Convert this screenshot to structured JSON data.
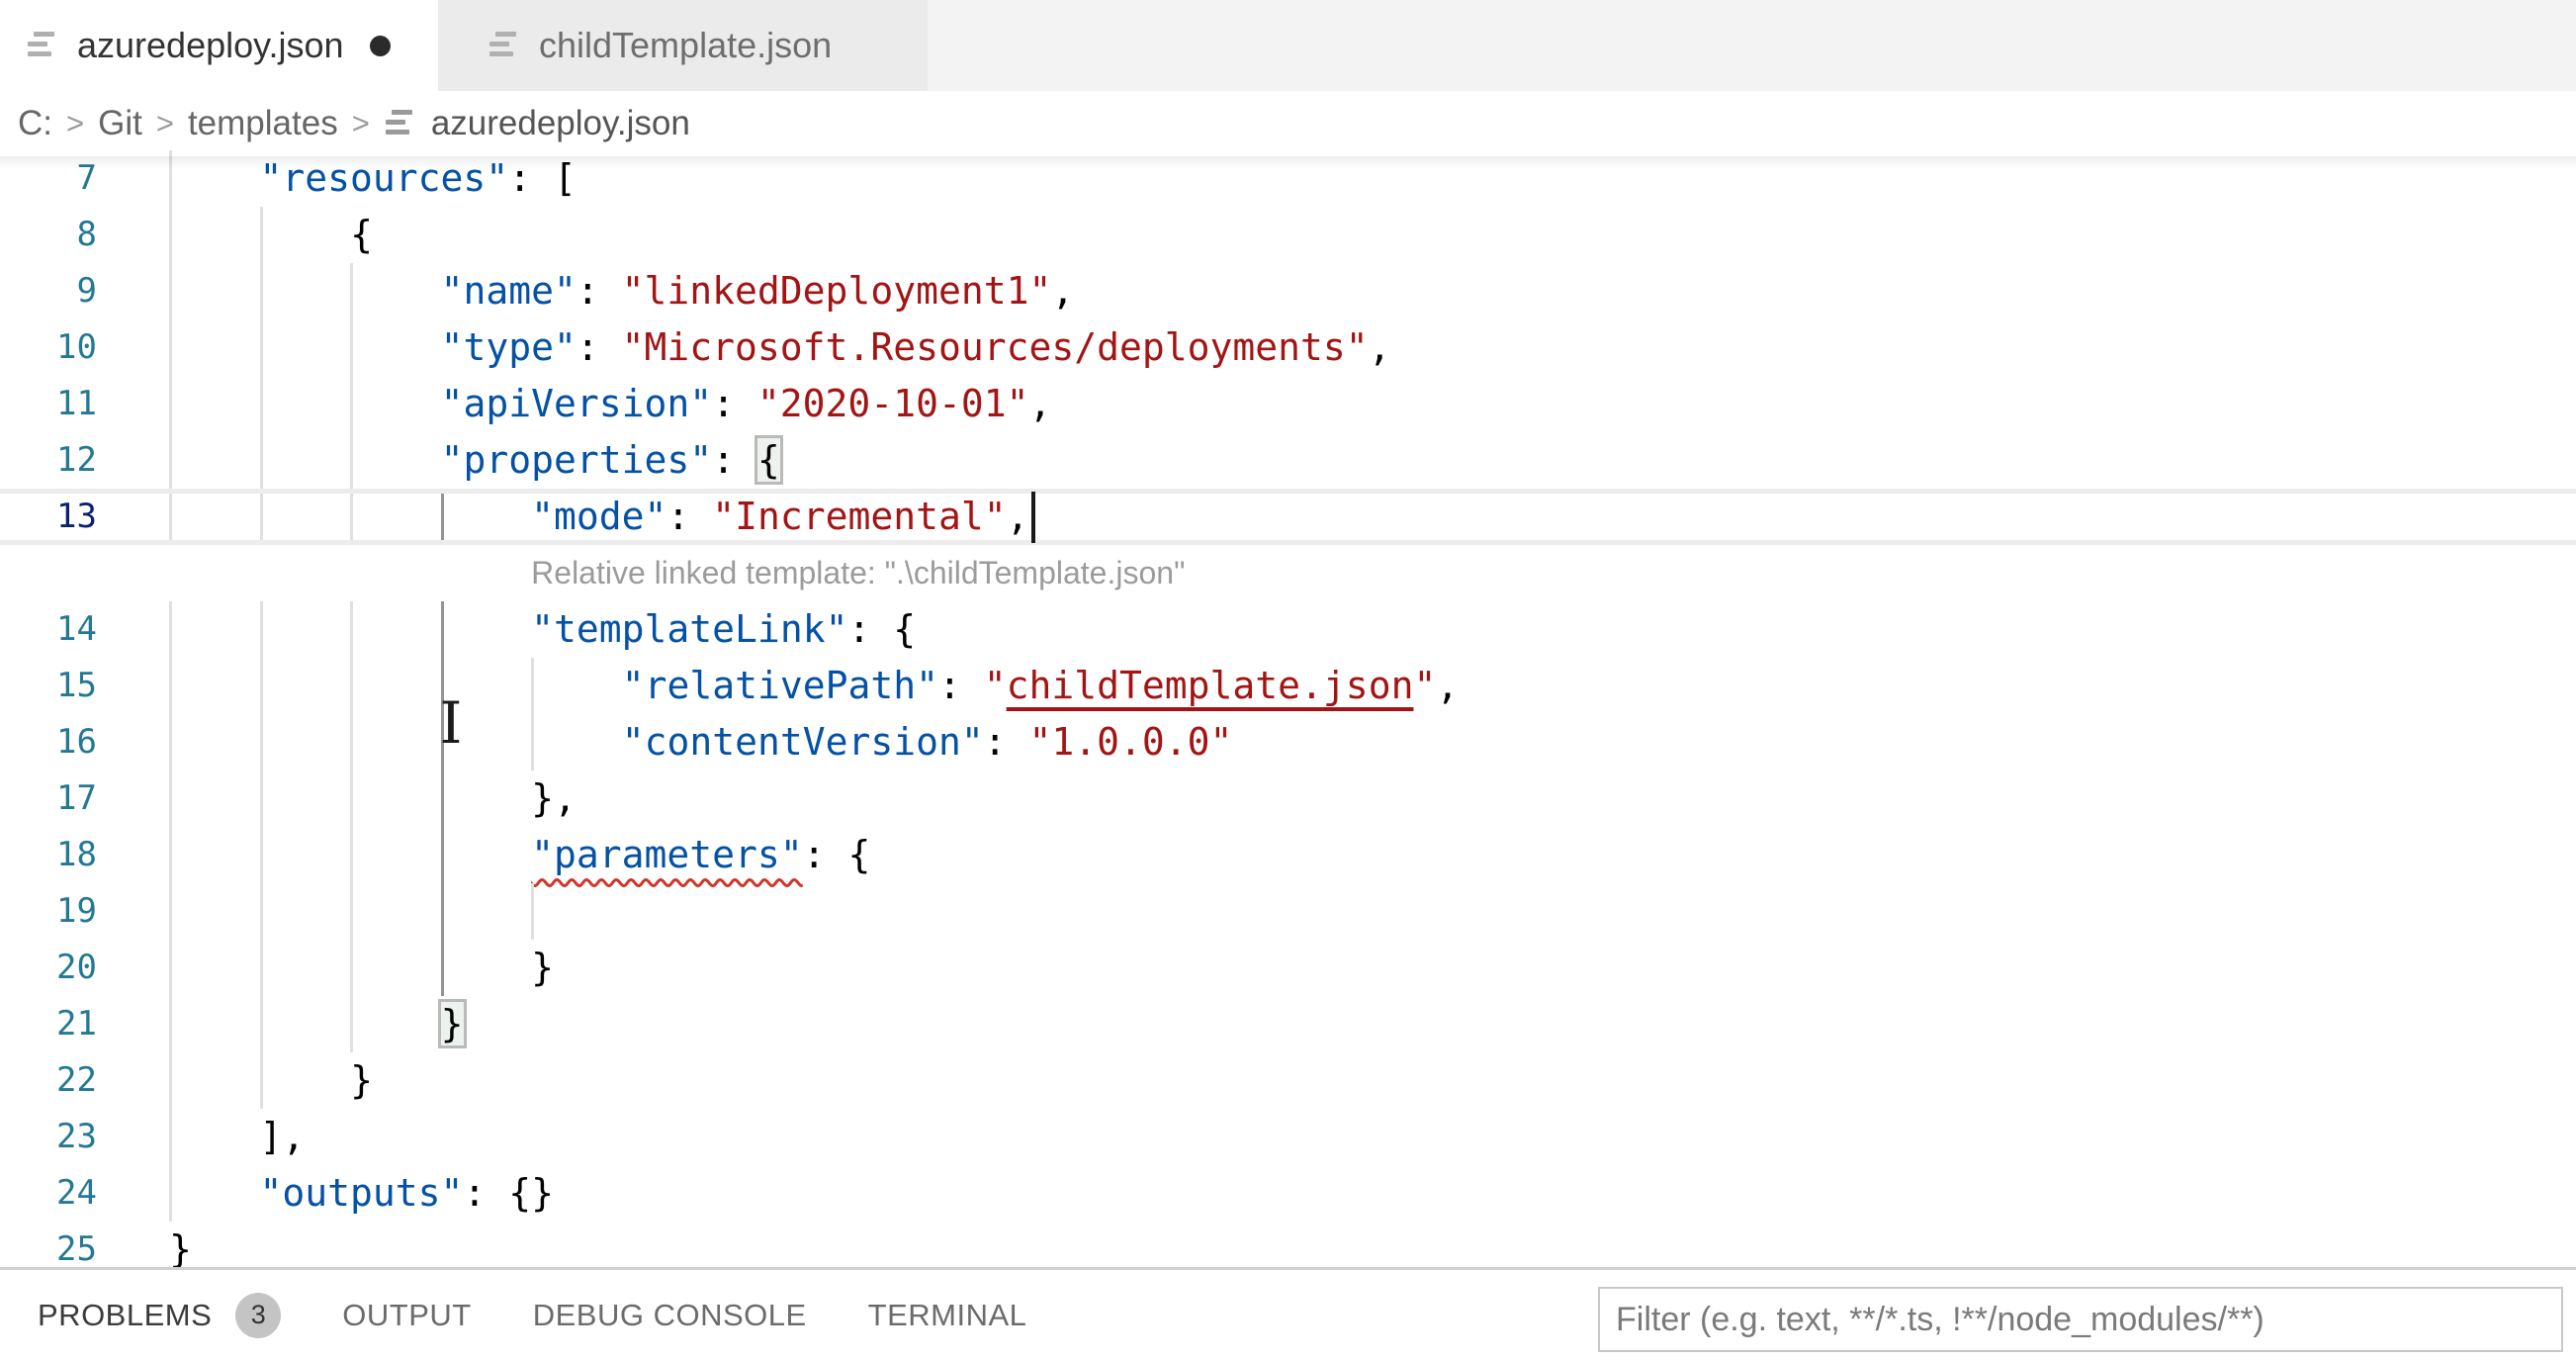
{
  "tabs": [
    {
      "title": "azuredeploy.json",
      "dirty": true,
      "active": true
    },
    {
      "title": "childTemplate.json",
      "dirty": false,
      "active": false
    }
  ],
  "breadcrumb": {
    "segments": [
      "C:",
      "Git",
      "templates"
    ],
    "separator": ">",
    "file": "azuredeploy.json"
  },
  "editor": {
    "lines": [
      {
        "num": 7,
        "indent": 4,
        "guides": [
          0
        ],
        "tokens": [
          [
            "key",
            "\"resources\""
          ],
          [
            "p",
            ": ["
          ]
        ]
      },
      {
        "num": 8,
        "indent": 8,
        "guides": [
          0,
          4
        ],
        "tokens": [
          [
            "p",
            "{"
          ]
        ]
      },
      {
        "num": 9,
        "indent": 12,
        "guides": [
          0,
          4,
          8
        ],
        "tokens": [
          [
            "key",
            "\"name\""
          ],
          [
            "p",
            ": "
          ],
          [
            "s",
            "\"linkedDeployment1\""
          ],
          [
            "p",
            ","
          ]
        ]
      },
      {
        "num": 10,
        "indent": 12,
        "guides": [
          0,
          4,
          8
        ],
        "tokens": [
          [
            "key",
            "\"type\""
          ],
          [
            "p",
            ": "
          ],
          [
            "s",
            "\"Microsoft.Resources/deployments\""
          ],
          [
            "p",
            ","
          ]
        ]
      },
      {
        "num": 11,
        "indent": 12,
        "guides": [
          0,
          4,
          8
        ],
        "tokens": [
          [
            "key",
            "\"apiVersion\""
          ],
          [
            "p",
            ": "
          ],
          [
            "s",
            "\"2020-10-01\""
          ],
          [
            "p",
            ","
          ]
        ]
      },
      {
        "num": 12,
        "indent": 12,
        "guides": [
          0,
          4,
          8
        ],
        "tokens": [
          [
            "key",
            "\"properties\""
          ],
          [
            "p",
            ": "
          ],
          [
            "bm",
            "{"
          ]
        ]
      },
      {
        "num": 13,
        "indent": 16,
        "guides": [
          0,
          4,
          8
        ],
        "active_guide": 12,
        "current": true,
        "caret": true,
        "tokens": [
          [
            "key",
            "\"mode\""
          ],
          [
            "p",
            ": "
          ],
          [
            "s",
            "\"Incremental\""
          ],
          [
            "p",
            ","
          ]
        ]
      },
      {
        "hint": "Relative linked template: \".\\childTemplate.json\""
      },
      {
        "num": 14,
        "indent": 16,
        "guides": [
          0,
          4,
          8
        ],
        "active_guide": 12,
        "tokens": [
          [
            "key",
            "\"templateLink\""
          ],
          [
            "p",
            ": {"
          ]
        ]
      },
      {
        "num": 15,
        "indent": 20,
        "guides": [
          0,
          4,
          8,
          16
        ],
        "active_guide": 12,
        "tokens": [
          [
            "key",
            "\"relativePath\""
          ],
          [
            "p",
            ": "
          ],
          [
            "s",
            "\""
          ],
          [
            "slink",
            "childTemplate.json"
          ],
          [
            "s",
            "\""
          ],
          [
            "p",
            ","
          ]
        ]
      },
      {
        "num": 16,
        "indent": 20,
        "guides": [
          0,
          4,
          8,
          16
        ],
        "active_guide": 12,
        "tokens": [
          [
            "key",
            "\"contentVersion\""
          ],
          [
            "p",
            ": "
          ],
          [
            "s",
            "\"1.0.0.0\""
          ]
        ]
      },
      {
        "num": 17,
        "indent": 16,
        "guides": [
          0,
          4,
          8
        ],
        "active_guide": 12,
        "tokens": [
          [
            "p",
            "},"
          ]
        ]
      },
      {
        "num": 18,
        "indent": 16,
        "guides": [
          0,
          4,
          8
        ],
        "active_guide": 12,
        "tokens": [
          [
            "keyerr",
            "\"parameters\""
          ],
          [
            "p",
            ": {"
          ]
        ]
      },
      {
        "num": 19,
        "indent": 0,
        "guides": [
          0,
          4,
          8,
          16
        ],
        "active_guide": 12,
        "tokens": []
      },
      {
        "num": 20,
        "indent": 16,
        "guides": [
          0,
          4,
          8
        ],
        "active_guide": 12,
        "tokens": [
          [
            "p",
            "}"
          ]
        ]
      },
      {
        "num": 21,
        "indent": 12,
        "guides": [
          0,
          4,
          8
        ],
        "tokens": [
          [
            "bm",
            "}"
          ]
        ]
      },
      {
        "num": 22,
        "indent": 8,
        "guides": [
          0,
          4
        ],
        "tokens": [
          [
            "p",
            "}"
          ]
        ]
      },
      {
        "num": 23,
        "indent": 4,
        "guides": [
          0
        ],
        "tokens": [
          [
            "p",
            "],"
          ]
        ]
      },
      {
        "num": 24,
        "indent": 4,
        "guides": [
          0
        ],
        "tokens": [
          [
            "key",
            "\"outputs\""
          ],
          [
            "p",
            ": {}"
          ]
        ]
      },
      {
        "num": 25,
        "indent": 0,
        "guides": [],
        "tokens": [
          [
            "p",
            "}"
          ]
        ]
      }
    ]
  },
  "panel": {
    "tabs": [
      {
        "label": "PROBLEMS",
        "badge": "3",
        "active": true
      },
      {
        "label": "OUTPUT",
        "active": false
      },
      {
        "label": "DEBUG CONSOLE",
        "active": false
      },
      {
        "label": "TERMINAL",
        "active": false
      }
    ],
    "filter_placeholder": "Filter (e.g. text, **/*.ts, !**/node_modules/**)"
  },
  "colors": {
    "key": "#0451a5",
    "string": "#a31515",
    "punct": "#000000",
    "lineno": "#237893",
    "lineno_active": "#0b216f",
    "guide": "#e0e0e0",
    "guide_active": "#949494",
    "error": "#d13428",
    "hint": "#9b9b9b",
    "cur_border": "#ececec",
    "tabbar_bg": "#f3f3f3",
    "tab_inactive_bg": "#ebebeb",
    "badge": "#c4c4c4"
  }
}
